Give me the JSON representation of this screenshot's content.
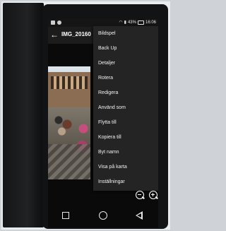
{
  "status_bar": {
    "battery": "43%",
    "time": "16:06"
  },
  "app_bar": {
    "title": "IMG_20160"
  },
  "menu": {
    "items": [
      {
        "label": "Bildspel"
      },
      {
        "label": "Back Up"
      },
      {
        "label": "Detaljer"
      },
      {
        "label": "Rotera"
      },
      {
        "label": "Redigera"
      },
      {
        "label": "Använd som"
      },
      {
        "label": "Flytta till"
      },
      {
        "label": "Kopiera till"
      },
      {
        "label": "Byt namn"
      },
      {
        "label": "Visa på karta"
      },
      {
        "label": "Inställningar"
      }
    ]
  },
  "icons": {
    "back": "arrow-left-icon",
    "zoom_out": "zoom-out-icon",
    "zoom_in": "zoom-in-icon",
    "recents": "square-icon",
    "home": "circle-icon",
    "nav_back": "triangle-back-icon"
  },
  "colors": {
    "menu_background": "#242424",
    "menu_text": "#f2f2f2",
    "status_bar": "#151515"
  }
}
